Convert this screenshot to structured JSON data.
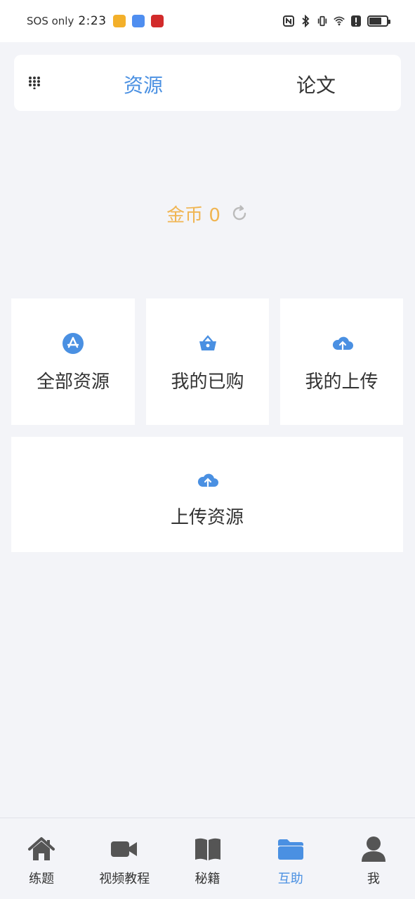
{
  "status_bar": {
    "sos": "SOS only",
    "time": "2:23",
    "notif_colors": [
      "#f3b02a",
      "#4f8ef0",
      "#d22b2b"
    ]
  },
  "tabs": [
    {
      "label": "资源",
      "active": true
    },
    {
      "label": "论文",
      "active": false
    }
  ],
  "coins": {
    "label": "金币 0"
  },
  "cards": [
    {
      "label": "全部资源",
      "icon": "app-store-icon"
    },
    {
      "label": "我的已购",
      "icon": "basket-icon"
    },
    {
      "label": "我的上传",
      "icon": "cloud-upload-icon"
    },
    {
      "label": "上传资源",
      "icon": "cloud-upload-icon"
    }
  ],
  "nav": [
    {
      "label": "练题",
      "icon": "home-icon",
      "active": false
    },
    {
      "label": "视频教程",
      "icon": "video-camera-icon",
      "active": false
    },
    {
      "label": "秘籍",
      "icon": "book-icon",
      "active": false
    },
    {
      "label": "互助",
      "icon": "folder-icon",
      "active": true
    },
    {
      "label": "我",
      "icon": "user-icon",
      "active": false
    }
  ],
  "colors": {
    "accent": "#4a90e2",
    "coin": "#f0b552",
    "background": "#f3f4f8",
    "icon_gray": "#555555"
  }
}
